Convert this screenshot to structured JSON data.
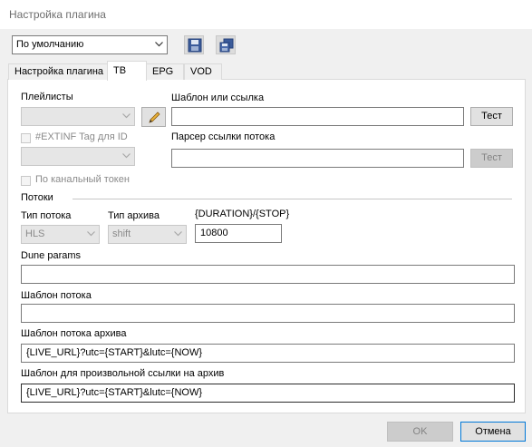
{
  "window": {
    "title": "Настройка плагина"
  },
  "toolbar": {
    "preset": "По умолчанию",
    "save_icon": "floppy-disk-icon",
    "save_all_icon": "multiple-floppy-icon"
  },
  "tabs": [
    {
      "label": "Настройка плагина"
    },
    {
      "label": "ТВ"
    },
    {
      "label": "EPG"
    },
    {
      "label": "VOD"
    }
  ],
  "playlists": {
    "label": "Плейлисты",
    "selected": "",
    "edit_icon": "pencil-icon",
    "extinf_label": "#EXTINF Tag для ID",
    "extinf_selected": "",
    "per_channel_token_label": "По канальный токен"
  },
  "template": {
    "label": "Шаблон или ссылка",
    "value": "",
    "test_label": "Тест",
    "parser_label": "Парсер ссылки потока",
    "parser_value": "",
    "parser_test_label": "Тест"
  },
  "streams": {
    "section_label": "Потоки",
    "stream_type_label": "Тип потока",
    "stream_type_value": "HLS",
    "archive_type_label": "Тип архива",
    "archive_type_value": "shift",
    "duration_label": "{DURATION}/{STOP}",
    "duration_value": "10800",
    "dune_params_label": "Dune params",
    "dune_params_value": "",
    "stream_template_label": "Шаблон потока",
    "stream_template_value": "",
    "archive_template_label": "Шаблон потока архива",
    "archive_template_value": "{LIVE_URL}?utc={START}&lutc={NOW}",
    "custom_archive_label": "Шаблон для произвольной ссылки на архив",
    "custom_archive_value": "{LIVE_URL}?utc={START}&lutc={NOW}"
  },
  "footer": {
    "ok_label": "OK",
    "cancel_label": "Отмена"
  },
  "colors": {
    "accent": "#0078d7",
    "disabled_bg": "#e6e6e6",
    "panel_bg": "#ffffff",
    "window_bg": "#f0f0f0"
  }
}
